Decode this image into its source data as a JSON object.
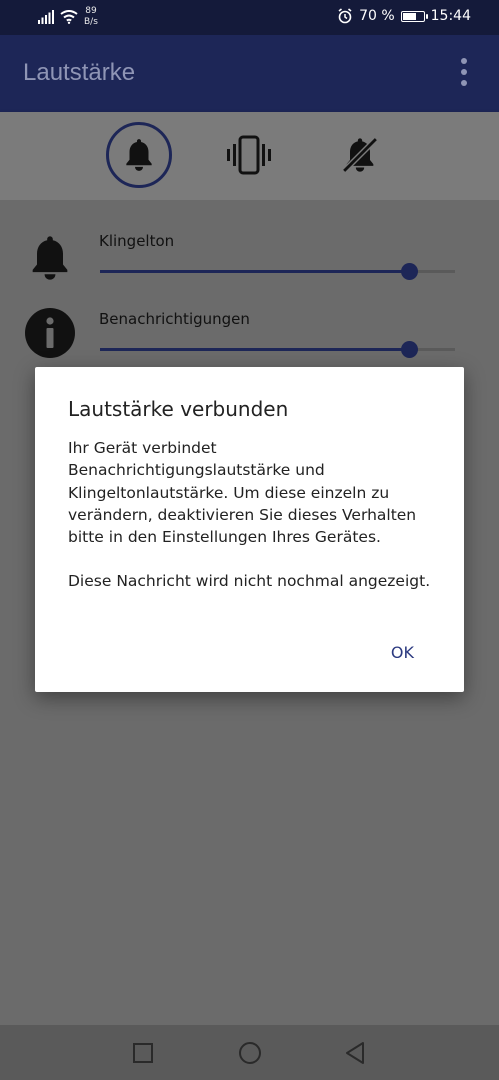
{
  "status_bar": {
    "net_speed_value": "89",
    "net_speed_unit": "B/s",
    "battery_percent": "70 %",
    "battery_level": 0.7,
    "time": "15:44"
  },
  "app_bar": {
    "title": "Lautstärke"
  },
  "modes": [
    {
      "name": "ring",
      "icon": "bell-icon",
      "active": true
    },
    {
      "name": "vibrate",
      "icon": "vibrate-icon",
      "active": false
    },
    {
      "name": "mute",
      "icon": "bell-off-icon",
      "active": false
    }
  ],
  "volume_rows": [
    {
      "label": "Klingelton",
      "icon": "bell-icon",
      "level": 0.87
    },
    {
      "label": "Benachrichtigungen",
      "icon": "info-icon",
      "level": 0.87
    }
  ],
  "dialog": {
    "title": "Lautstärke verbunden",
    "paragraph1": "Ihr Gerät verbindet Benachrichtigungslautstärke und Klingeltonlautstärke. Um diese einzeln zu verändern, deaktivieren Sie dieses Verhalten bitte in den Einstellungen Ihres Gerätes.",
    "paragraph2": "Diese Nachricht wird nicht nochmal angezeigt.",
    "ok_label": "OK"
  },
  "colors": {
    "primary": "#1d2657",
    "accent_text": "#2c3a80"
  }
}
